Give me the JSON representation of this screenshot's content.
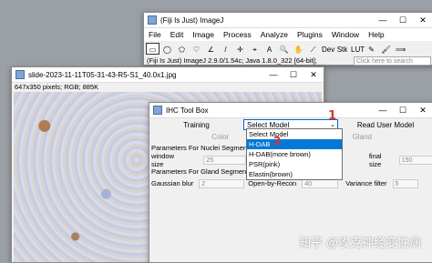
{
  "imagej": {
    "title": "(Fiji Is Just) ImageJ",
    "menu": [
      "File",
      "Edit",
      "Image",
      "Process",
      "Analyze",
      "Plugins",
      "Window",
      "Help"
    ],
    "tools": [
      "▭",
      "◯",
      "⬠",
      "♡",
      "∠",
      "/",
      "✛",
      "⌖",
      "A",
      "🔍",
      "✋",
      "⟋",
      "Dev",
      "Stk",
      "LUT",
      "✎",
      "🖌",
      "⟹"
    ],
    "status": "(Fiji Is Just) ImageJ 2.9.0/1.54c; Java 1.8.0_322 [64-bit];",
    "search_placeholder": "Click here to search"
  },
  "image_window": {
    "title": "slide-2023-11-11T05-31-43-R5-S1_40.0x1.jpg",
    "info": "647x350 pixels; RGB; 885K"
  },
  "ihc": {
    "title": "IHC Tool Box",
    "training": "Training",
    "select_value": "Select Model",
    "read_model": "Read User Model",
    "tab_color": "Color",
    "tab_gland": "Gland",
    "nuclei_header": "Parameters For Nuclei Segmentation",
    "window_size": "window size",
    "window_val": "25",
    "gland_header": "Parameters For Gland Segmentation",
    "gaussian": "Gaussian blur",
    "gaussian_val": "2",
    "open_recon": "Open-by-Recon",
    "open_val": "40",
    "final_size": "final size",
    "final_val": "150",
    "variance": "Variance filter",
    "variance_val": "5",
    "options": [
      "Select Model",
      "H-DAB",
      "H-DAB(more brown)",
      "PSR(pink)",
      "Elastin(brown)"
    ],
    "selected_index": 1
  },
  "annotations": {
    "mark1": "1",
    "mark2": "2"
  },
  "watermark": "知乎 @攻克神经变性病"
}
